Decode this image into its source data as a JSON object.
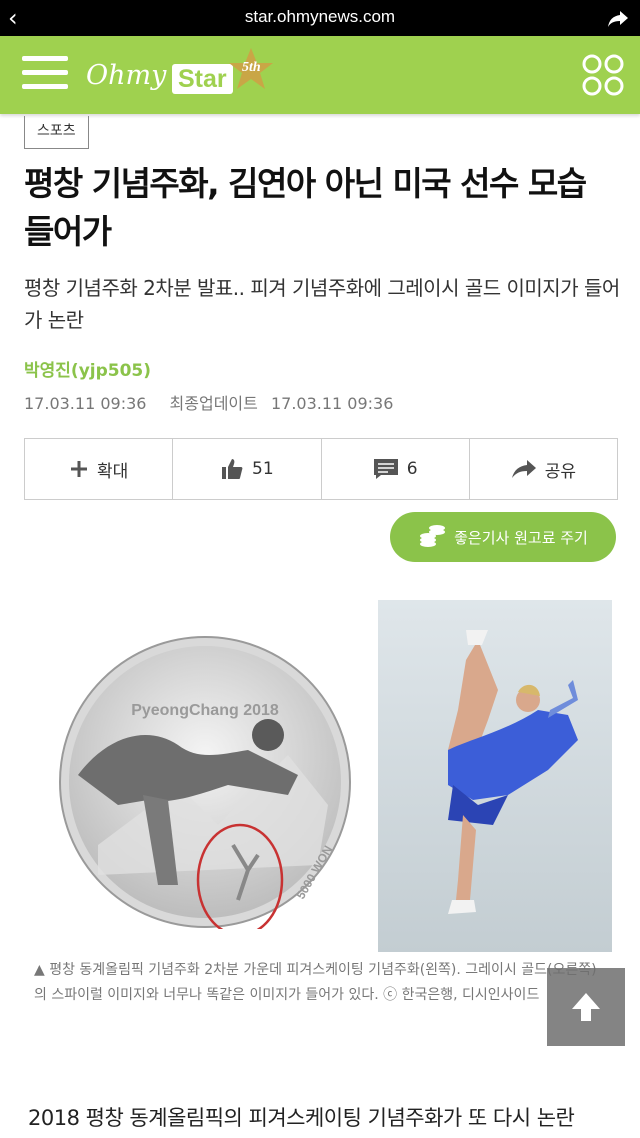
{
  "browser": {
    "url": "star.ohmynews.com",
    "back_icon": "back-chevron-icon",
    "share_icon": "share-arrow-icon"
  },
  "header": {
    "logo_text_1": "Ohmy",
    "logo_text_2": "Star",
    "anniversary": "5th",
    "accent": "#9fd14f"
  },
  "article": {
    "category": "스포츠",
    "title": "평창 기념주화, 김연아 아닌 미국 선수 모습 들어가",
    "subtitle": "평창 기념주화 2차분 발표.. 피겨 기념주화에 그레이시 골드 이미지가 들어가 논란",
    "author": "박영진(yjp505)",
    "published": "17.03.11 09:36",
    "updated_label": "최종업데이트",
    "updated": "17.03.11 09:36"
  },
  "actions": {
    "zoom": "확대",
    "likes": "51",
    "comments": "6",
    "share": "공유"
  },
  "donate_label": "좋은기사 원고료 주기",
  "image": {
    "coin_text": "PyeongChang 2018",
    "coin_value": "5000 WON"
  },
  "caption": "▲ 평창 동계올림픽 기념주화 2차분 가운데 피겨스케이팅 기념주화(왼쪽). 그레이시 골드(오른쪽)의 스파이럴 이미지와 너무나 똑같은 이미지가 들어가 있다. ⓒ 한국은행, 디시인사이드",
  "body_first_line": "2018 평창 동계올림픽의 피겨스케이팅 기념주화가 또 다시 논란"
}
